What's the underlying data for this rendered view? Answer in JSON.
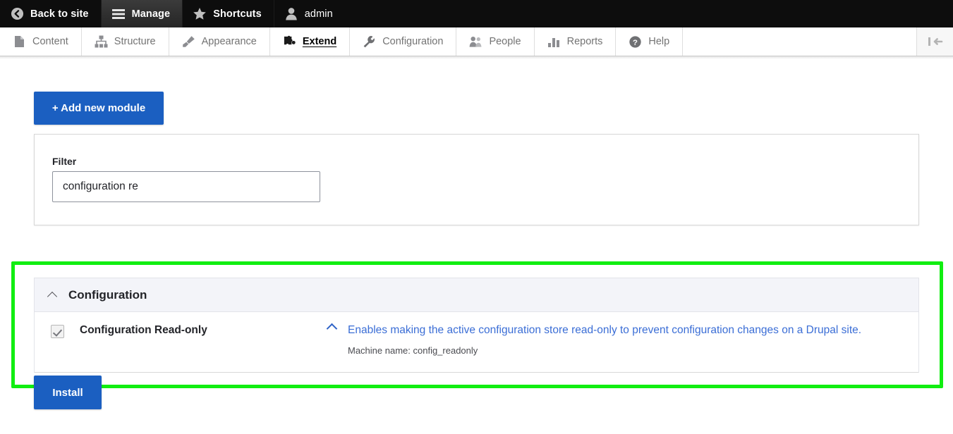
{
  "admin_bar": {
    "items": [
      {
        "label": "Back to site",
        "icon": "back-arrow-icon",
        "active": false
      },
      {
        "label": "Manage",
        "icon": "hamburger-icon",
        "active": true
      },
      {
        "label": "Shortcuts",
        "icon": "star-icon",
        "active": false
      },
      {
        "label": "admin",
        "icon": "user-icon",
        "active": false
      }
    ]
  },
  "menu_bar": {
    "items": [
      {
        "label": "Content",
        "icon": "document-icon",
        "active": false
      },
      {
        "label": "Structure",
        "icon": "sitemap-icon",
        "active": false
      },
      {
        "label": "Appearance",
        "icon": "paintbrush-icon",
        "active": false
      },
      {
        "label": "Extend",
        "icon": "puzzle-icon",
        "active": true
      },
      {
        "label": "Configuration",
        "icon": "wrench-icon",
        "active": false
      },
      {
        "label": "People",
        "icon": "people-icon",
        "active": false
      },
      {
        "label": "Reports",
        "icon": "bar-chart-icon",
        "active": false
      },
      {
        "label": "Help",
        "icon": "question-circle-icon",
        "active": false
      }
    ],
    "collapse_icon": "collapse-sidebar-icon"
  },
  "actions": {
    "add_module_label": "+ Add new module",
    "install_label": "Install"
  },
  "filter": {
    "label": "Filter",
    "value": "configuration re",
    "placeholder": ""
  },
  "config_section": {
    "title": "Configuration",
    "collapse_icon": "chevron-up-icon",
    "modules": [
      {
        "checked": true,
        "name": "Configuration Read-only",
        "description": "Enables making the active configuration store read-only to prevent configuration changes on a Drupal site.",
        "machine_name_label": "Machine name: config_readonly",
        "toggle_icon": "chevron-up-icon"
      }
    ]
  },
  "colors": {
    "primary_blue": "#1b5fc1",
    "link_blue": "#3b6ed6",
    "highlight_green": "#11ee11",
    "toolbar_black": "#0d0d0d",
    "accordion_header": "#f3f4f9"
  }
}
